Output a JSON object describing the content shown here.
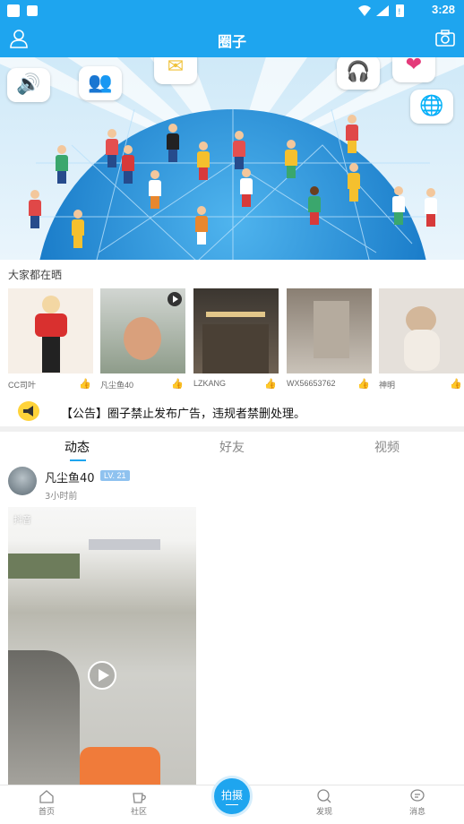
{
  "status_bar": {
    "time": "3:28"
  },
  "header": {
    "title": "圈子"
  },
  "section": {
    "title": "大家都在晒"
  },
  "thumbs": [
    {
      "name": "CC司叶",
      "has_video": false
    },
    {
      "name": "凡尘鱼40",
      "has_video": true
    },
    {
      "name": "LZKANG",
      "has_video": false
    },
    {
      "name": "WX56653762",
      "has_video": false
    },
    {
      "name": "神明",
      "has_video": false
    }
  ],
  "notice": {
    "text": "【公告】圈子禁止发布广告，违规者禁删处理。"
  },
  "tabs": [
    {
      "label": "动态",
      "active": true
    },
    {
      "label": "好友",
      "active": false
    },
    {
      "label": "视频",
      "active": false
    }
  ],
  "post": {
    "username": "凡尘鱼40",
    "level": "LV. 21",
    "time": "3小时前",
    "video_watermark": "抖音"
  },
  "nav": {
    "home": "首页",
    "community": "社区",
    "shoot": "拍摄",
    "discover": "发现",
    "messages": "消息"
  },
  "colors": {
    "primary": "#1ea5ef",
    "level_badge": "#8fc2ef"
  }
}
